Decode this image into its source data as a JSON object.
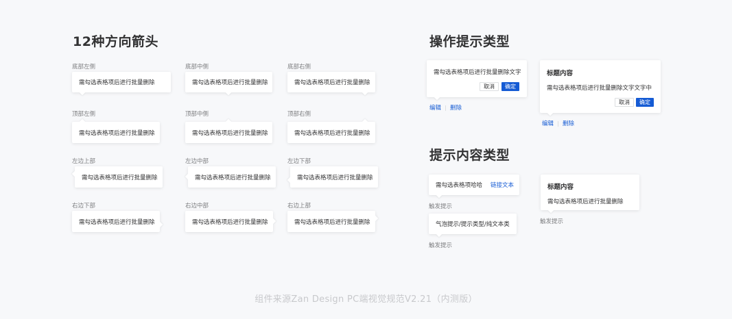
{
  "left_section": {
    "title": "12种方向箭头",
    "rows": [
      [
        {
          "caption": "底部左侧",
          "text": "需勾选表格项后进行批量删除"
        },
        {
          "caption": "底部中侧",
          "text": "需勾选表格项后进行批量删除"
        },
        {
          "caption": "底部右侧",
          "text": "需勾选表格项后进行批量删除"
        }
      ],
      [
        {
          "caption": "顶部左侧",
          "text": "需勾选表格项后进行批量删除"
        },
        {
          "caption": "顶部中侧",
          "text": "需勾选表格项后进行批量删除"
        },
        {
          "caption": "顶部右侧",
          "text": "需勾选表格项后进行批量删除"
        }
      ],
      [
        {
          "caption": "左边上部",
          "text": "需勾选表格项后进行批量删除"
        },
        {
          "caption": "左边中部",
          "text": "需勾选表格项后进行批量删除"
        },
        {
          "caption": "左边下部",
          "text": "需勾选表格项后进行批量删除"
        }
      ],
      [
        {
          "caption": "右边下部",
          "text": "需勾选表格项后进行批量删除"
        },
        {
          "caption": "右边中部",
          "text": "需勾选表格项后进行批量删除"
        },
        {
          "caption": "右边上部",
          "text": "需勾选表格项后进行批量删除"
        }
      ]
    ]
  },
  "action_section": {
    "title": "操作提示类型",
    "simple": {
      "text": "需勾选表格项后进行批量删除文字",
      "cancel": "取消",
      "ok": "确定",
      "link_edit": "编辑",
      "link_delete": "删除"
    },
    "with_title": {
      "title": "标题内容",
      "text": "需勾选表格项后进行批量删除文字文字中",
      "cancel": "取消",
      "ok": "确定",
      "link_edit": "编辑",
      "link_delete": "删除"
    }
  },
  "content_section": {
    "title": "提示内容类型",
    "link_tip": {
      "text": "需勾选表格项哈哈",
      "link": "链接文本",
      "trigger": "触发提示"
    },
    "plain_tip": {
      "text": "气泡提示/提示类型/纯文本类",
      "trigger": "触发提示"
    },
    "title_tip": {
      "title": "标题内容",
      "text": "需勾选表格项后进行批量删除",
      "trigger": "触发提示"
    }
  },
  "footer": {
    "text": "组件来源Zan Design PC端视觉规范V2.21（内测版）"
  },
  "colors": {
    "background": "#f7f8fa",
    "primary": "#155bd4",
    "text": "#323233",
    "caption": "#7d7e80"
  }
}
